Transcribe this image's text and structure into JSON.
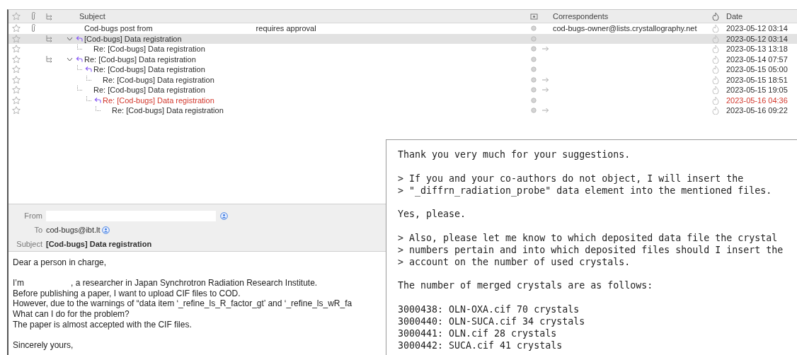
{
  "message_list": {
    "columns": [
      {
        "kind": "star"
      },
      {
        "kind": "attachment"
      },
      {
        "kind": "thread"
      },
      {
        "kind": "text",
        "label": "Subject"
      },
      {
        "kind": "read"
      },
      {
        "kind": "text",
        "label": "Correspondents"
      },
      {
        "kind": "junk"
      },
      {
        "kind": "text",
        "label": "Date"
      }
    ],
    "messages": [
      {
        "subject": "Cod-bugs post from",
        "subject_tail": "requires approval",
        "correspondent": "cod-bugs-owner@lists.crystallography.net",
        "date": "2023-05-12 03:14",
        "attachment": true,
        "replied": false,
        "forwarded": false,
        "selected": false,
        "tagged": false
      },
      {
        "subject": "[Cod-bugs] Data registration",
        "date": "2023-05-12 03:14",
        "attachment": false,
        "replied": true,
        "forwarded": false,
        "selected": true,
        "tagged": false,
        "expanded": true,
        "children": [
          {
            "subject": "Re: [Cod-bugs] Data registration",
            "date": "2023-05-13 13:18",
            "attachment": false,
            "replied": false,
            "forwarded": true,
            "selected": false,
            "tagged": false
          }
        ]
      },
      {
        "subject": "Re: [Cod-bugs] Data registration",
        "date": "2023-05-14 07:57",
        "attachment": false,
        "replied": true,
        "forwarded": false,
        "selected": false,
        "tagged": false,
        "expanded": true,
        "children": [
          {
            "subject": "Re: [Cod-bugs] Data registration",
            "date": "2023-05-15 05:00",
            "attachment": false,
            "replied": true,
            "forwarded": false,
            "selected": false,
            "tagged": false,
            "children": [
              {
                "subject": "Re: [Cod-bugs] Data registration",
                "date": "2023-05-15 18:51",
                "attachment": false,
                "replied": false,
                "forwarded": true,
                "selected": false,
                "tagged": false
              }
            ]
          },
          {
            "subject": "Re: [Cod-bugs] Data registration",
            "date": "2023-05-15 19:05",
            "attachment": false,
            "replied": false,
            "forwarded": true,
            "selected": false,
            "tagged": false,
            "children": [
              {
                "subject": "Re: [Cod-bugs] Data registration",
                "date": "2023-05-16 04:36",
                "attachment": false,
                "replied": true,
                "forwarded": false,
                "selected": false,
                "tagged": true,
                "children": [
                  {
                    "subject": "Re: [Cod-bugs] Data registration",
                    "date": "2023-05-16 09:22",
                    "attachment": false,
                    "replied": false,
                    "forwarded": true,
                    "selected": false,
                    "tagged": false
                  }
                ]
              }
            ]
          }
        ]
      }
    ]
  },
  "preview": {
    "from_label": "From",
    "to_label": "To",
    "to": "cod-bugs@ibt.lt",
    "subject_label": "Subject",
    "subject": "[Cod-bugs] Data registration",
    "body": [
      {
        "kind": "text",
        "parts": [
          "Dear a person in charge,"
        ]
      },
      {
        "kind": "blank"
      },
      {
        "kind": "text",
        "parts": [
          "I’m",
          ", a researcher in Japan Synchrotron Radiation Research Institute."
        ]
      },
      {
        "kind": "text",
        "parts": [
          "Before publishing a paper, I want to upload CIF files to COD."
        ]
      },
      {
        "kind": "text",
        "parts": [
          "However, due to the warnings of “data item ‘_refine_ls_R_factor_gt’ and ‘_refine_ls_wR_fa"
        ]
      },
      {
        "kind": "text",
        "parts": [
          "What can I do for the problem?"
        ]
      },
      {
        "kind": "text",
        "parts": [
          "The paper is almost accepted with the CIF files."
        ]
      },
      {
        "kind": "blank"
      },
      {
        "kind": "text",
        "parts": [
          "Sincerely yours,"
        ]
      }
    ]
  },
  "reply_window": {
    "lines": [
      {
        "kind": "text",
        "text": "Thank you very much for your suggestions."
      },
      {
        "kind": "blank"
      },
      {
        "kind": "text",
        "text": "> If you and your co-authors do not object, I will insert the"
      },
      {
        "kind": "text",
        "text": "> \"_diffrn_radiation_probe\" data element into the mentioned files."
      },
      {
        "kind": "blank"
      },
      {
        "kind": "text",
        "text": "Yes, please."
      },
      {
        "kind": "blank"
      },
      {
        "kind": "text",
        "text": "> Also, please let me know to which deposited data file the crystal"
      },
      {
        "kind": "text",
        "text": "> numbers pertain and into which deposited files should I insert the"
      },
      {
        "kind": "text",
        "text": "> account on the number of used crystals."
      },
      {
        "kind": "blank"
      },
      {
        "kind": "text",
        "text": "The number of merged crystals are as follows:"
      },
      {
        "kind": "blank"
      },
      {
        "kind": "text",
        "text": "3000438: OLN-OXA.cif 70 crystals"
      },
      {
        "kind": "text",
        "text": "3000440: OLN-SUCA.cif 34 crystals"
      },
      {
        "kind": "text",
        "text": "3000441: OLN.cif 28 crystals"
      },
      {
        "kind": "text",
        "text": "3000442: SUCA.cif 41 crystals"
      }
    ]
  }
}
